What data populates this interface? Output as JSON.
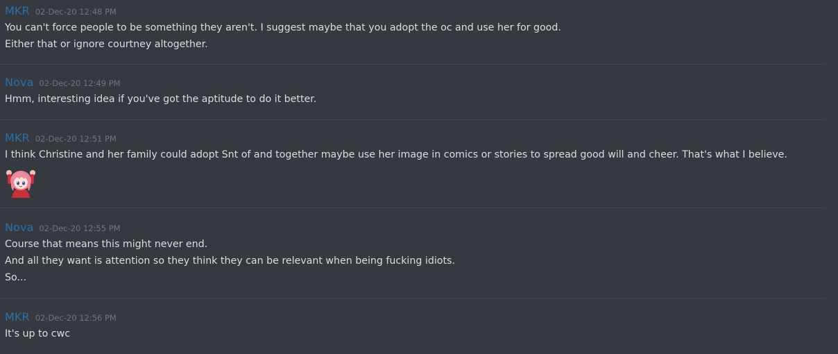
{
  "colors": {
    "background": "#36393f",
    "author": "#2e6fa8",
    "timestamp": "#72767d",
    "text": "#dcddde",
    "divider": "#42454a"
  },
  "messages": [
    {
      "author": "MKR",
      "timestamp": "02-Dec-20 12:48 PM",
      "lines": [
        "You can't force people to be something they aren't. I suggest maybe that you adopt the oc and use her for good.",
        "Either that or ignore courtney altogether."
      ]
    },
    {
      "author": "Nova",
      "timestamp": "02-Dec-20 12:49 PM",
      "lines": [
        "Hmm, interesting idea if you've got the aptitude to do it better."
      ]
    },
    {
      "author": "MKR",
      "timestamp": "02-Dec-20 12:51 PM",
      "lines": [
        "I think Christine and her family could adopt Snt of and together maybe use her image in comics or stories to spread good will and cheer. That's what I believe."
      ],
      "sticker": "pink-haired-anime-girl-cheering-sticker"
    },
    {
      "author": "Nova",
      "timestamp": "02-Dec-20 12:55 PM",
      "lines": [
        "Course that means this might never end.",
        "And all they want is attention so they think they can be relevant when being fucking idiots.",
        "So..."
      ]
    },
    {
      "author": "MKR",
      "timestamp": "02-Dec-20 12:56 PM",
      "lines": [
        "It's up to cwc"
      ]
    }
  ]
}
